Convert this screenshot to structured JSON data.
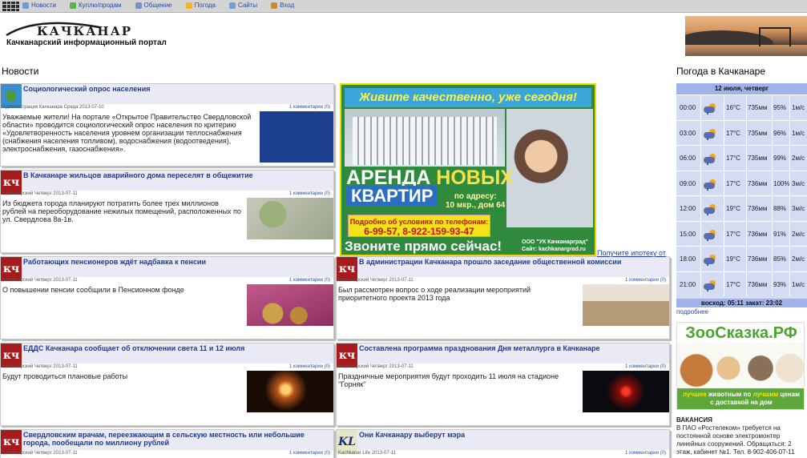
{
  "nav": [
    {
      "label": "Новости",
      "icon": "document-icon",
      "color": "#6f9bd8"
    },
    {
      "label": "Куплю/продам",
      "icon": "recycle-icon",
      "color": "#5bb04a"
    },
    {
      "label": "Общение",
      "icon": "chat-icon",
      "color": "#7b8fc9"
    },
    {
      "label": "Погода",
      "icon": "sun-icon",
      "color": "#f2b325"
    },
    {
      "label": "Сайты",
      "icon": "page-icon",
      "color": "#6fa3d8"
    },
    {
      "label": "Вход",
      "icon": "login-icon",
      "color": "#c88c3a"
    }
  ],
  "header": {
    "logo": "КАЧКАНАР",
    "subtitle": "Качканарский информационный портал"
  },
  "sections": {
    "news": "Новости",
    "weather": "Погода в Качканаре"
  },
  "news": [
    {
      "title": "Социологический опрос населения",
      "badge": "coat",
      "meta_left": "Администрация Качканара Среда 2013-07-10",
      "meta_right": "1 комментарии (0)",
      "text": "Уважаемые жители! На портале «Открытое Правительство Свердловской области» проводится социологический опрос населения по критерию «Удовлетворенность населения уровнем организации теплоснабжения (снабжения населения топливом), водоснабжения (водоотведения), электроснабжения, газоснабжения».",
      "thumb": "open-gov"
    },
    {
      "title": "В Качканаре жильцов аварийного дома переселят в общежитие",
      "badge": "кч",
      "meta_left": "Качканарский Четверг 2013-07-11",
      "meta_right": "1 комментарии (0)",
      "text": "Из бюджета города планируют потратить более трех миллионов рублей на переоборудование нежилых помещений, расположенных по ул. Свердлова 8а-1в.",
      "thumb": "map"
    },
    {
      "title": "Работающих пенсионеров ждёт надбавка к пенсии",
      "badge": "кч",
      "meta_left": "Качканарский Четверг 2013-07-11",
      "meta_right": "1 комментарии (0)",
      "text": "О повышении пенсии сообщили в Пенсионном фонде",
      "thumb": "coins"
    },
    {
      "title": "В администрации Качканара прошло заседание общественной комиссии",
      "badge": "кч",
      "meta_left": "Качканарский Четверг 2013-07-11",
      "meta_right": "1 комментарии (0)",
      "text": "Был рассмотрен вопрос о ходе реализации мероприятий приоритетного проекта 2013 года",
      "thumb": "meeting"
    },
    {
      "title": "ЕДДС Качканара сообщает об отключении света 11 и 12 июля",
      "badge": "кч",
      "meta_left": "Качканарский Четверг 2013-07-11",
      "meta_right": "1 комментарии (0)",
      "text": "Будут проводиться плановые работы",
      "thumb": "bulb"
    },
    {
      "title": "Составлена программа празднования Дня металлурга в Качканаре",
      "badge": "кч",
      "meta_left": "Качканарский Четверг 2013-07-11",
      "meta_right": "1 комментарии (0)",
      "text": "Праздничные мероприятия будут проходить 11 июля на стадионе \"Горняк\"",
      "thumb": "fireworks"
    },
    {
      "title": "Свердловским врачам, переезжающим в сельскую местность или небольшие города, пообещали по миллиону рублей",
      "badge": "кч",
      "meta_left": "Качканарский Четверг 2013-07-11",
      "meta_right": "1 комментарии (0)",
      "text": "",
      "thumb": ""
    },
    {
      "title": "Они Качканару выберут мэра",
      "badge": "KL",
      "meta_left": "Kachkanar Life 2013-07-11",
      "meta_right": "1 комментарии (0)",
      "text": "",
      "thumb": ""
    }
  ],
  "ad": {
    "slogan": "Живите качественно, уже сегодня!",
    "line1a": "АРЕНДА",
    "line1b": "НОВЫХ",
    "line2": "КВАРТИР",
    "address": "по адресу:\n10 мкр., дом 64",
    "phones_caption": "Подробно об условиях по телефонам:",
    "phones": "6-99-57, 8-922-159-93-47",
    "call": "Звоните прямо сейчас!",
    "site": "ООО \"УК Качканарград\"\nСайт: kachkanargrad.ru",
    "mortgage_link": "Получите ипотеку от"
  },
  "weather": {
    "date": "12 июля, четверг",
    "rows": [
      {
        "time": "00:00",
        "temp": "16°C",
        "pressure": "735мм",
        "humidity": "95%",
        "wind": "1м/с"
      },
      {
        "time": "03:00",
        "temp": "17°C",
        "pressure": "735мм",
        "humidity": "96%",
        "wind": "1м/с"
      },
      {
        "time": "06:00",
        "temp": "17°C",
        "pressure": "735мм",
        "humidity": "99%",
        "wind": "2м/с"
      },
      {
        "time": "09:00",
        "temp": "17°C",
        "pressure": "736мм",
        "humidity": "100%",
        "wind": "3м/с"
      },
      {
        "time": "12:00",
        "temp": "19°C",
        "pressure": "736мм",
        "humidity": "88%",
        "wind": "3м/с"
      },
      {
        "time": "15:00",
        "temp": "17°C",
        "pressure": "736мм",
        "humidity": "91%",
        "wind": "2м/с"
      },
      {
        "time": "18:00",
        "temp": "19°C",
        "pressure": "736мм",
        "humidity": "85%",
        "wind": "2м/с"
      },
      {
        "time": "21:00",
        "temp": "17°C",
        "pressure": "736мм",
        "humidity": "93%",
        "wind": "1м/с"
      }
    ],
    "sun": "восход: 05:11 закат: 23:02",
    "more": "подробнее"
  },
  "zoo": {
    "title": "ЗооСказка.РФ",
    "tagline_a": "лучшее",
    "tagline_b": " животным по ",
    "tagline_c": "лучшим",
    "tagline_d": " ценам",
    "tagline_e": "с доставкой на дом"
  },
  "vacancy": {
    "title": "ВАКАНСИЯ",
    "text": "В ПАО «Ростелеком» требуется на постоянной основе электромонтер линейных сооружений. Обращаться: 2 этаж, кабинет №1. Тел. 8-902-406-07-11"
  }
}
